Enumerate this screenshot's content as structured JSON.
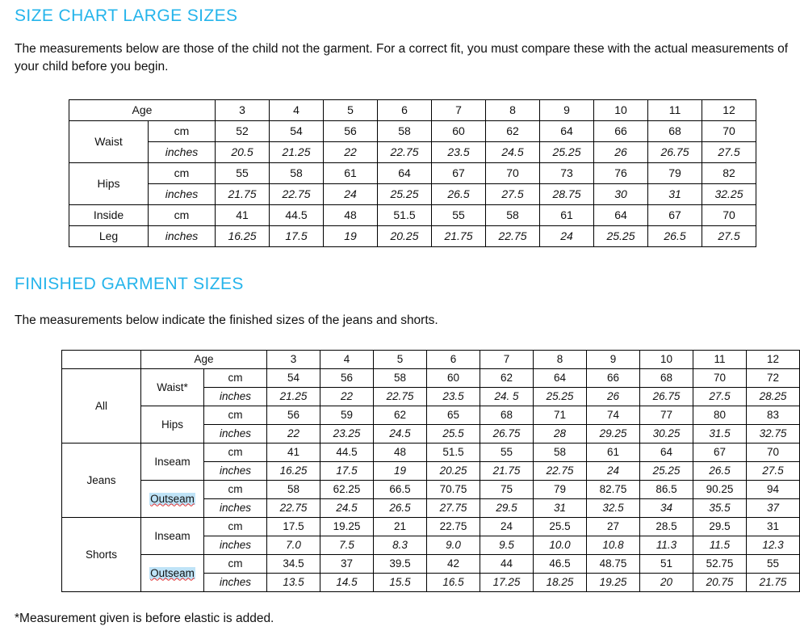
{
  "section1": {
    "title": "SIZE CHART LARGE SIZES",
    "intro": "The measurements below are those of the child not the garment.  For a correct fit, you must compare these with the actual measurements of your child before you begin.",
    "table": {
      "header_label": "Age",
      "ages": [
        "3",
        "4",
        "5",
        "6",
        "7",
        "8",
        "9",
        "10",
        "11",
        "12"
      ],
      "unit_cm": "cm",
      "unit_inches": "inches",
      "groups": [
        {
          "label": "Waist",
          "cm": [
            "52",
            "54",
            "56",
            "58",
            "60",
            "62",
            "64",
            "66",
            "68",
            "70"
          ],
          "inches": [
            "20.5",
            "21.25",
            "22",
            "22.75",
            "23.5",
            "24.5",
            "25.25",
            "26",
            "26.75",
            "27.5"
          ]
        },
        {
          "label": "Hips",
          "cm": [
            "55",
            "58",
            "61",
            "64",
            "67",
            "70",
            "73",
            "76",
            "79",
            "82"
          ],
          "inches": [
            "21.75",
            "22.75",
            "24",
            "25.25",
            "26.5",
            "27.5",
            "28.75",
            "30",
            "31",
            "32.25"
          ]
        },
        {
          "label": "Inside",
          "label2": "Leg",
          "cm": [
            "41",
            "44.5",
            "48",
            "51.5",
            "55",
            "58",
            "61",
            "64",
            "67",
            "70"
          ],
          "inches": [
            "16.25",
            "17.5",
            "19",
            "20.25",
            "21.75",
            "22.75",
            "24",
            "25.25",
            "26.5",
            "27.5"
          ]
        }
      ]
    }
  },
  "section2": {
    "title": "FINISHED GARMENT SIZES",
    "intro": "The measurements below indicate the finished sizes of the jeans and shorts.",
    "footnote": "*Measurement given is before elastic is added.",
    "table": {
      "header_label": "Age",
      "ages": [
        "3",
        "4",
        "5",
        "6",
        "7",
        "8",
        "9",
        "10",
        "11",
        "12"
      ],
      "unit_cm": "cm",
      "unit_inches": "inches",
      "groups": [
        {
          "name": "All",
          "measures": [
            {
              "label": "Waist*",
              "misspelled": false,
              "cm": [
                "54",
                "56",
                "58",
                "60",
                "62",
                "64",
                "66",
                "68",
                "70",
                "72"
              ],
              "inches": [
                "21.25",
                "22",
                "22.75",
                "23.5",
                "24. 5",
                "25.25",
                "26",
                "26.75",
                "27.5",
                "28.25"
              ]
            },
            {
              "label": "Hips",
              "misspelled": false,
              "cm": [
                "56",
                "59",
                "62",
                "65",
                "68",
                "71",
                "74",
                "77",
                "80",
                "83"
              ],
              "inches": [
                "22",
                "23.25",
                "24.5",
                "25.5",
                "26.75",
                "28",
                "29.25",
                "30.25",
                "31.5",
                "32.75"
              ]
            }
          ]
        },
        {
          "name": "Jeans",
          "measures": [
            {
              "label": "Inseam",
              "misspelled": false,
              "cm": [
                "41",
                "44.5",
                "48",
                "51.5",
                "55",
                "58",
                "61",
                "64",
                "67",
                "70"
              ],
              "inches": [
                "16.25",
                "17.5",
                "19",
                "20.25",
                "21.75",
                "22.75",
                "24",
                "25.25",
                "26.5",
                "27.5"
              ]
            },
            {
              "label": "Outseam",
              "misspelled": true,
              "cm": [
                "58",
                "62.25",
                "66.5",
                "70.75",
                "75",
                "79",
                "82.75",
                "86.5",
                "90.25",
                "94"
              ],
              "inches": [
                "22.75",
                "24.5",
                "26.5",
                "27.75",
                "29.5",
                "31",
                "32.5",
                "34",
                "35.5",
                "37"
              ]
            }
          ]
        },
        {
          "name": "Shorts",
          "measures": [
            {
              "label": "Inseam",
              "misspelled": false,
              "cm": [
                "17.5",
                "19.25",
                "21",
                "22.75",
                "24",
                "25.5",
                "27",
                "28.5",
                "29.5",
                "31"
              ],
              "inches": [
                "7.0",
                "7.5",
                "8.3",
                "9.0",
                "9.5",
                "10.0",
                "10.8",
                "11.3",
                "11.5",
                "12.3"
              ]
            },
            {
              "label": "Outseam",
              "misspelled": true,
              "cm": [
                "34.5",
                "37",
                "39.5",
                "42",
                "44",
                "46.5",
                "48.75",
                "51",
                "52.75",
                "55"
              ],
              "inches": [
                "13.5",
                "14.5",
                "15.5",
                "16.5",
                "17.25",
                "18.25",
                "19.25",
                "20",
                "20.75",
                "21.75"
              ]
            }
          ]
        }
      ]
    }
  },
  "colors": {
    "heading_blue": "#25b4eb",
    "spellcheck_red": "#e03030",
    "selection_blue": "#bfe3f7",
    "border": "#000000",
    "text": "#111111"
  }
}
